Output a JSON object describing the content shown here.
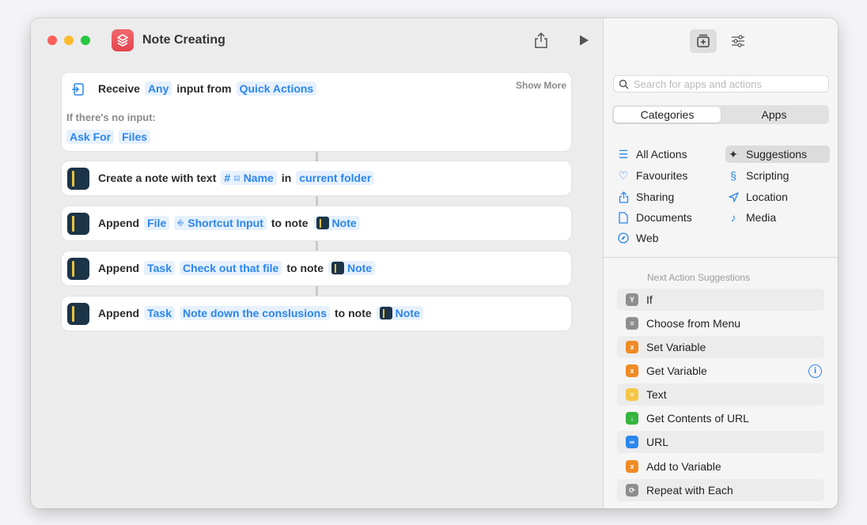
{
  "window": {
    "title": "Note Creating"
  },
  "actions": [
    {
      "id": "receive",
      "receive": "Receive",
      "any": "Any",
      "input_from": "input from",
      "source": "Quick Actions",
      "show_more": "Show More",
      "no_input_label": "If there's no input:",
      "ask_for": "Ask For",
      "files": "Files"
    },
    {
      "id": "create",
      "text": "Create a note with text",
      "hash": "#",
      "name_var": "Name",
      "in": "in",
      "folder": "current folder"
    },
    {
      "id": "append1",
      "verb": "Append",
      "type": "File",
      "content": "Shortcut Input",
      "to_note": "to note",
      "note": "Note"
    },
    {
      "id": "append2",
      "verb": "Append",
      "type": "Task",
      "content": "Check out that file",
      "to_note": "to note",
      "note": "Note"
    },
    {
      "id": "append3",
      "verb": "Append",
      "type": "Task",
      "content": "Note down the conslusions",
      "to_note": "to note",
      "note": "Note"
    }
  ],
  "sidebar": {
    "search_placeholder": "Search for apps and actions",
    "segments": [
      "Categories",
      "Apps"
    ],
    "categories_left": [
      {
        "label": "All Actions",
        "icon": "list-icon"
      },
      {
        "label": "Favourites",
        "icon": "heart-icon"
      },
      {
        "label": "Sharing",
        "icon": "share-icon"
      },
      {
        "label": "Documents",
        "icon": "document-icon"
      },
      {
        "label": "Web",
        "icon": "compass-icon"
      }
    ],
    "categories_right": [
      {
        "label": "Suggestions",
        "icon": "sparkle-icon"
      },
      {
        "label": "Scripting",
        "icon": "scripting-icon"
      },
      {
        "label": "Location",
        "icon": "location-icon"
      },
      {
        "label": "Media",
        "icon": "music-icon"
      }
    ],
    "suggestions_header": "Next Action Suggestions",
    "suggestions": [
      {
        "label": "If",
        "color": "#8e8e8e",
        "glyph": "Y"
      },
      {
        "label": "Choose from Menu",
        "color": "#8e8e8e",
        "glyph": "≡"
      },
      {
        "label": "Set Variable",
        "color": "#f08a24",
        "glyph": "x"
      },
      {
        "label": "Get Variable",
        "color": "#f08a24",
        "glyph": "x"
      },
      {
        "label": "Text",
        "color": "#f6c744",
        "glyph": "≡"
      },
      {
        "label": "Get Contents of URL",
        "color": "#35b43e",
        "glyph": "↓"
      },
      {
        "label": "URL",
        "color": "#2b86ee",
        "glyph": "∞"
      },
      {
        "label": "Add to Variable",
        "color": "#f08a24",
        "glyph": "x"
      },
      {
        "label": "Repeat with Each",
        "color": "#8e8e8e",
        "glyph": "⟳"
      }
    ]
  }
}
